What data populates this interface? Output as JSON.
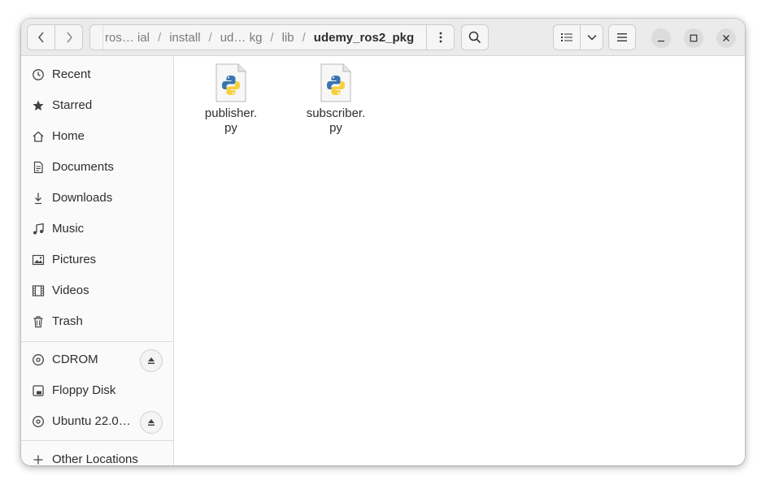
{
  "toolbar": {
    "path": [
      {
        "label": "ros… ial",
        "current": false
      },
      {
        "label": "install",
        "current": false
      },
      {
        "label": "ud… kg",
        "current": false
      },
      {
        "label": "lib",
        "current": false
      },
      {
        "label": "udemy_ros2_pkg",
        "current": true
      }
    ],
    "separator": "/"
  },
  "sidebar": {
    "items": [
      {
        "label": "Recent",
        "icon": "clock-icon"
      },
      {
        "label": "Starred",
        "icon": "star-icon"
      },
      {
        "label": "Home",
        "icon": "home-icon"
      },
      {
        "label": "Documents",
        "icon": "document-icon"
      },
      {
        "label": "Downloads",
        "icon": "download-icon"
      },
      {
        "label": "Music",
        "icon": "music-icon"
      },
      {
        "label": "Pictures",
        "icon": "picture-icon"
      },
      {
        "label": "Videos",
        "icon": "video-icon"
      },
      {
        "label": "Trash",
        "icon": "trash-icon"
      }
    ],
    "devices": [
      {
        "label": "CDROM",
        "icon": "disc-icon",
        "ejectable": true
      },
      {
        "label": "Floppy Disk",
        "icon": "drive-icon",
        "ejectable": false
      },
      {
        "label": "Ubuntu 22.0…",
        "icon": "disc-icon",
        "ejectable": true
      }
    ],
    "other": {
      "label": "Other Locations",
      "icon": "plus-icon"
    }
  },
  "files": [
    {
      "name_line1": "publisher.",
      "name_line2": "py",
      "icon": "python-file-icon"
    },
    {
      "name_line1": "subscriber.",
      "name_line2": "py",
      "icon": "python-file-icon"
    }
  ],
  "colors": {
    "headerbar": "#ebebeb",
    "sidebar": "#fafafa",
    "python_blue": "#3a75b0",
    "python_yellow": "#f7cf3e"
  }
}
